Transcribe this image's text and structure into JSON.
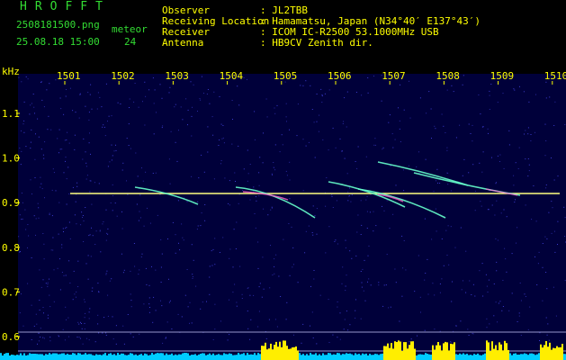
{
  "header": {
    "title": "HROFFT",
    "filename": "2508181500.png",
    "datetime": "25.08.18 15:00",
    "meteor_label": "meteor",
    "meteor_count": "24",
    "info": [
      {
        "label": "Observer",
        "value": ": JL2TBB"
      },
      {
        "label": "Receiving Location",
        "value": ": Hamamatsu, Japan (N34°40′ E137°43′)"
      },
      {
        "label": "Receiver",
        "value": ": ICOM IC-R2500 53.1000MHz USB"
      },
      {
        "label": "Antenna",
        "value": ": HB9CV Zenith dir."
      }
    ]
  },
  "spectrogram": {
    "unit_label": "kHz",
    "x_ticks": [
      "1501",
      "1502",
      "1503",
      "1504",
      "1505",
      "1506",
      "1507",
      "1508",
      "1509",
      "1510"
    ],
    "y_ticks": [
      "1.1",
      "1.0",
      "0.9",
      "0.8",
      "0.7",
      "0.6"
    ],
    "colors": {
      "background": "#00003a",
      "text": "#ffff00",
      "carrier": "#ffff80",
      "meteor": "#66ffcc",
      "level_yellow": "#ffee00",
      "level_cyan": "#00ccff"
    }
  }
}
